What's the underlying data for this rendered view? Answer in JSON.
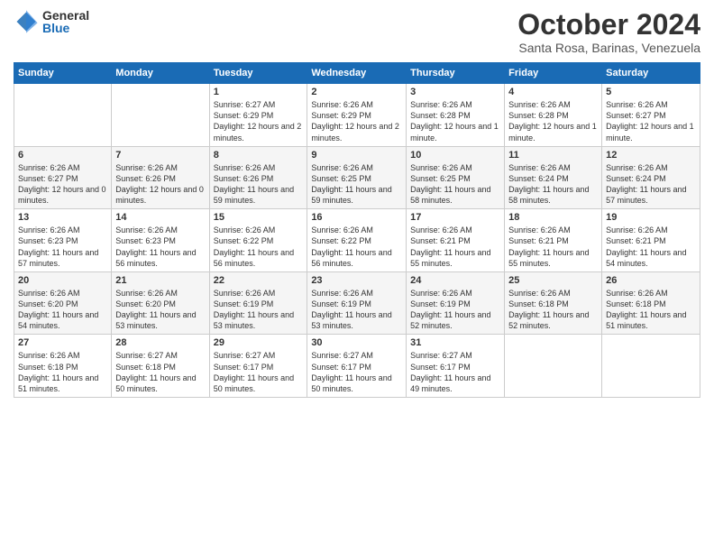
{
  "logo": {
    "general": "General",
    "blue": "Blue"
  },
  "header": {
    "month": "October 2024",
    "location": "Santa Rosa, Barinas, Venezuela"
  },
  "weekdays": [
    "Sunday",
    "Monday",
    "Tuesday",
    "Wednesday",
    "Thursday",
    "Friday",
    "Saturday"
  ],
  "weeks": [
    [
      {
        "day": "",
        "sunrise": "",
        "sunset": "",
        "daylight": ""
      },
      {
        "day": "",
        "sunrise": "",
        "sunset": "",
        "daylight": ""
      },
      {
        "day": "1",
        "sunrise": "Sunrise: 6:27 AM",
        "sunset": "Sunset: 6:29 PM",
        "daylight": "Daylight: 12 hours and 2 minutes."
      },
      {
        "day": "2",
        "sunrise": "Sunrise: 6:26 AM",
        "sunset": "Sunset: 6:29 PM",
        "daylight": "Daylight: 12 hours and 2 minutes."
      },
      {
        "day": "3",
        "sunrise": "Sunrise: 6:26 AM",
        "sunset": "Sunset: 6:28 PM",
        "daylight": "Daylight: 12 hours and 1 minute."
      },
      {
        "day": "4",
        "sunrise": "Sunrise: 6:26 AM",
        "sunset": "Sunset: 6:28 PM",
        "daylight": "Daylight: 12 hours and 1 minute."
      },
      {
        "day": "5",
        "sunrise": "Sunrise: 6:26 AM",
        "sunset": "Sunset: 6:27 PM",
        "daylight": "Daylight: 12 hours and 1 minute."
      }
    ],
    [
      {
        "day": "6",
        "sunrise": "Sunrise: 6:26 AM",
        "sunset": "Sunset: 6:27 PM",
        "daylight": "Daylight: 12 hours and 0 minutes."
      },
      {
        "day": "7",
        "sunrise": "Sunrise: 6:26 AM",
        "sunset": "Sunset: 6:26 PM",
        "daylight": "Daylight: 12 hours and 0 minutes."
      },
      {
        "day": "8",
        "sunrise": "Sunrise: 6:26 AM",
        "sunset": "Sunset: 6:26 PM",
        "daylight": "Daylight: 11 hours and 59 minutes."
      },
      {
        "day": "9",
        "sunrise": "Sunrise: 6:26 AM",
        "sunset": "Sunset: 6:25 PM",
        "daylight": "Daylight: 11 hours and 59 minutes."
      },
      {
        "day": "10",
        "sunrise": "Sunrise: 6:26 AM",
        "sunset": "Sunset: 6:25 PM",
        "daylight": "Daylight: 11 hours and 58 minutes."
      },
      {
        "day": "11",
        "sunrise": "Sunrise: 6:26 AM",
        "sunset": "Sunset: 6:24 PM",
        "daylight": "Daylight: 11 hours and 58 minutes."
      },
      {
        "day": "12",
        "sunrise": "Sunrise: 6:26 AM",
        "sunset": "Sunset: 6:24 PM",
        "daylight": "Daylight: 11 hours and 57 minutes."
      }
    ],
    [
      {
        "day": "13",
        "sunrise": "Sunrise: 6:26 AM",
        "sunset": "Sunset: 6:23 PM",
        "daylight": "Daylight: 11 hours and 57 minutes."
      },
      {
        "day": "14",
        "sunrise": "Sunrise: 6:26 AM",
        "sunset": "Sunset: 6:23 PM",
        "daylight": "Daylight: 11 hours and 56 minutes."
      },
      {
        "day": "15",
        "sunrise": "Sunrise: 6:26 AM",
        "sunset": "Sunset: 6:22 PM",
        "daylight": "Daylight: 11 hours and 56 minutes."
      },
      {
        "day": "16",
        "sunrise": "Sunrise: 6:26 AM",
        "sunset": "Sunset: 6:22 PM",
        "daylight": "Daylight: 11 hours and 56 minutes."
      },
      {
        "day": "17",
        "sunrise": "Sunrise: 6:26 AM",
        "sunset": "Sunset: 6:21 PM",
        "daylight": "Daylight: 11 hours and 55 minutes."
      },
      {
        "day": "18",
        "sunrise": "Sunrise: 6:26 AM",
        "sunset": "Sunset: 6:21 PM",
        "daylight": "Daylight: 11 hours and 55 minutes."
      },
      {
        "day": "19",
        "sunrise": "Sunrise: 6:26 AM",
        "sunset": "Sunset: 6:21 PM",
        "daylight": "Daylight: 11 hours and 54 minutes."
      }
    ],
    [
      {
        "day": "20",
        "sunrise": "Sunrise: 6:26 AM",
        "sunset": "Sunset: 6:20 PM",
        "daylight": "Daylight: 11 hours and 54 minutes."
      },
      {
        "day": "21",
        "sunrise": "Sunrise: 6:26 AM",
        "sunset": "Sunset: 6:20 PM",
        "daylight": "Daylight: 11 hours and 53 minutes."
      },
      {
        "day": "22",
        "sunrise": "Sunrise: 6:26 AM",
        "sunset": "Sunset: 6:19 PM",
        "daylight": "Daylight: 11 hours and 53 minutes."
      },
      {
        "day": "23",
        "sunrise": "Sunrise: 6:26 AM",
        "sunset": "Sunset: 6:19 PM",
        "daylight": "Daylight: 11 hours and 53 minutes."
      },
      {
        "day": "24",
        "sunrise": "Sunrise: 6:26 AM",
        "sunset": "Sunset: 6:19 PM",
        "daylight": "Daylight: 11 hours and 52 minutes."
      },
      {
        "day": "25",
        "sunrise": "Sunrise: 6:26 AM",
        "sunset": "Sunset: 6:18 PM",
        "daylight": "Daylight: 11 hours and 52 minutes."
      },
      {
        "day": "26",
        "sunrise": "Sunrise: 6:26 AM",
        "sunset": "Sunset: 6:18 PM",
        "daylight": "Daylight: 11 hours and 51 minutes."
      }
    ],
    [
      {
        "day": "27",
        "sunrise": "Sunrise: 6:26 AM",
        "sunset": "Sunset: 6:18 PM",
        "daylight": "Daylight: 11 hours and 51 minutes."
      },
      {
        "day": "28",
        "sunrise": "Sunrise: 6:27 AM",
        "sunset": "Sunset: 6:18 PM",
        "daylight": "Daylight: 11 hours and 50 minutes."
      },
      {
        "day": "29",
        "sunrise": "Sunrise: 6:27 AM",
        "sunset": "Sunset: 6:17 PM",
        "daylight": "Daylight: 11 hours and 50 minutes."
      },
      {
        "day": "30",
        "sunrise": "Sunrise: 6:27 AM",
        "sunset": "Sunset: 6:17 PM",
        "daylight": "Daylight: 11 hours and 50 minutes."
      },
      {
        "day": "31",
        "sunrise": "Sunrise: 6:27 AM",
        "sunset": "Sunset: 6:17 PM",
        "daylight": "Daylight: 11 hours and 49 minutes."
      },
      {
        "day": "",
        "sunrise": "",
        "sunset": "",
        "daylight": ""
      },
      {
        "day": "",
        "sunrise": "",
        "sunset": "",
        "daylight": ""
      }
    ]
  ]
}
